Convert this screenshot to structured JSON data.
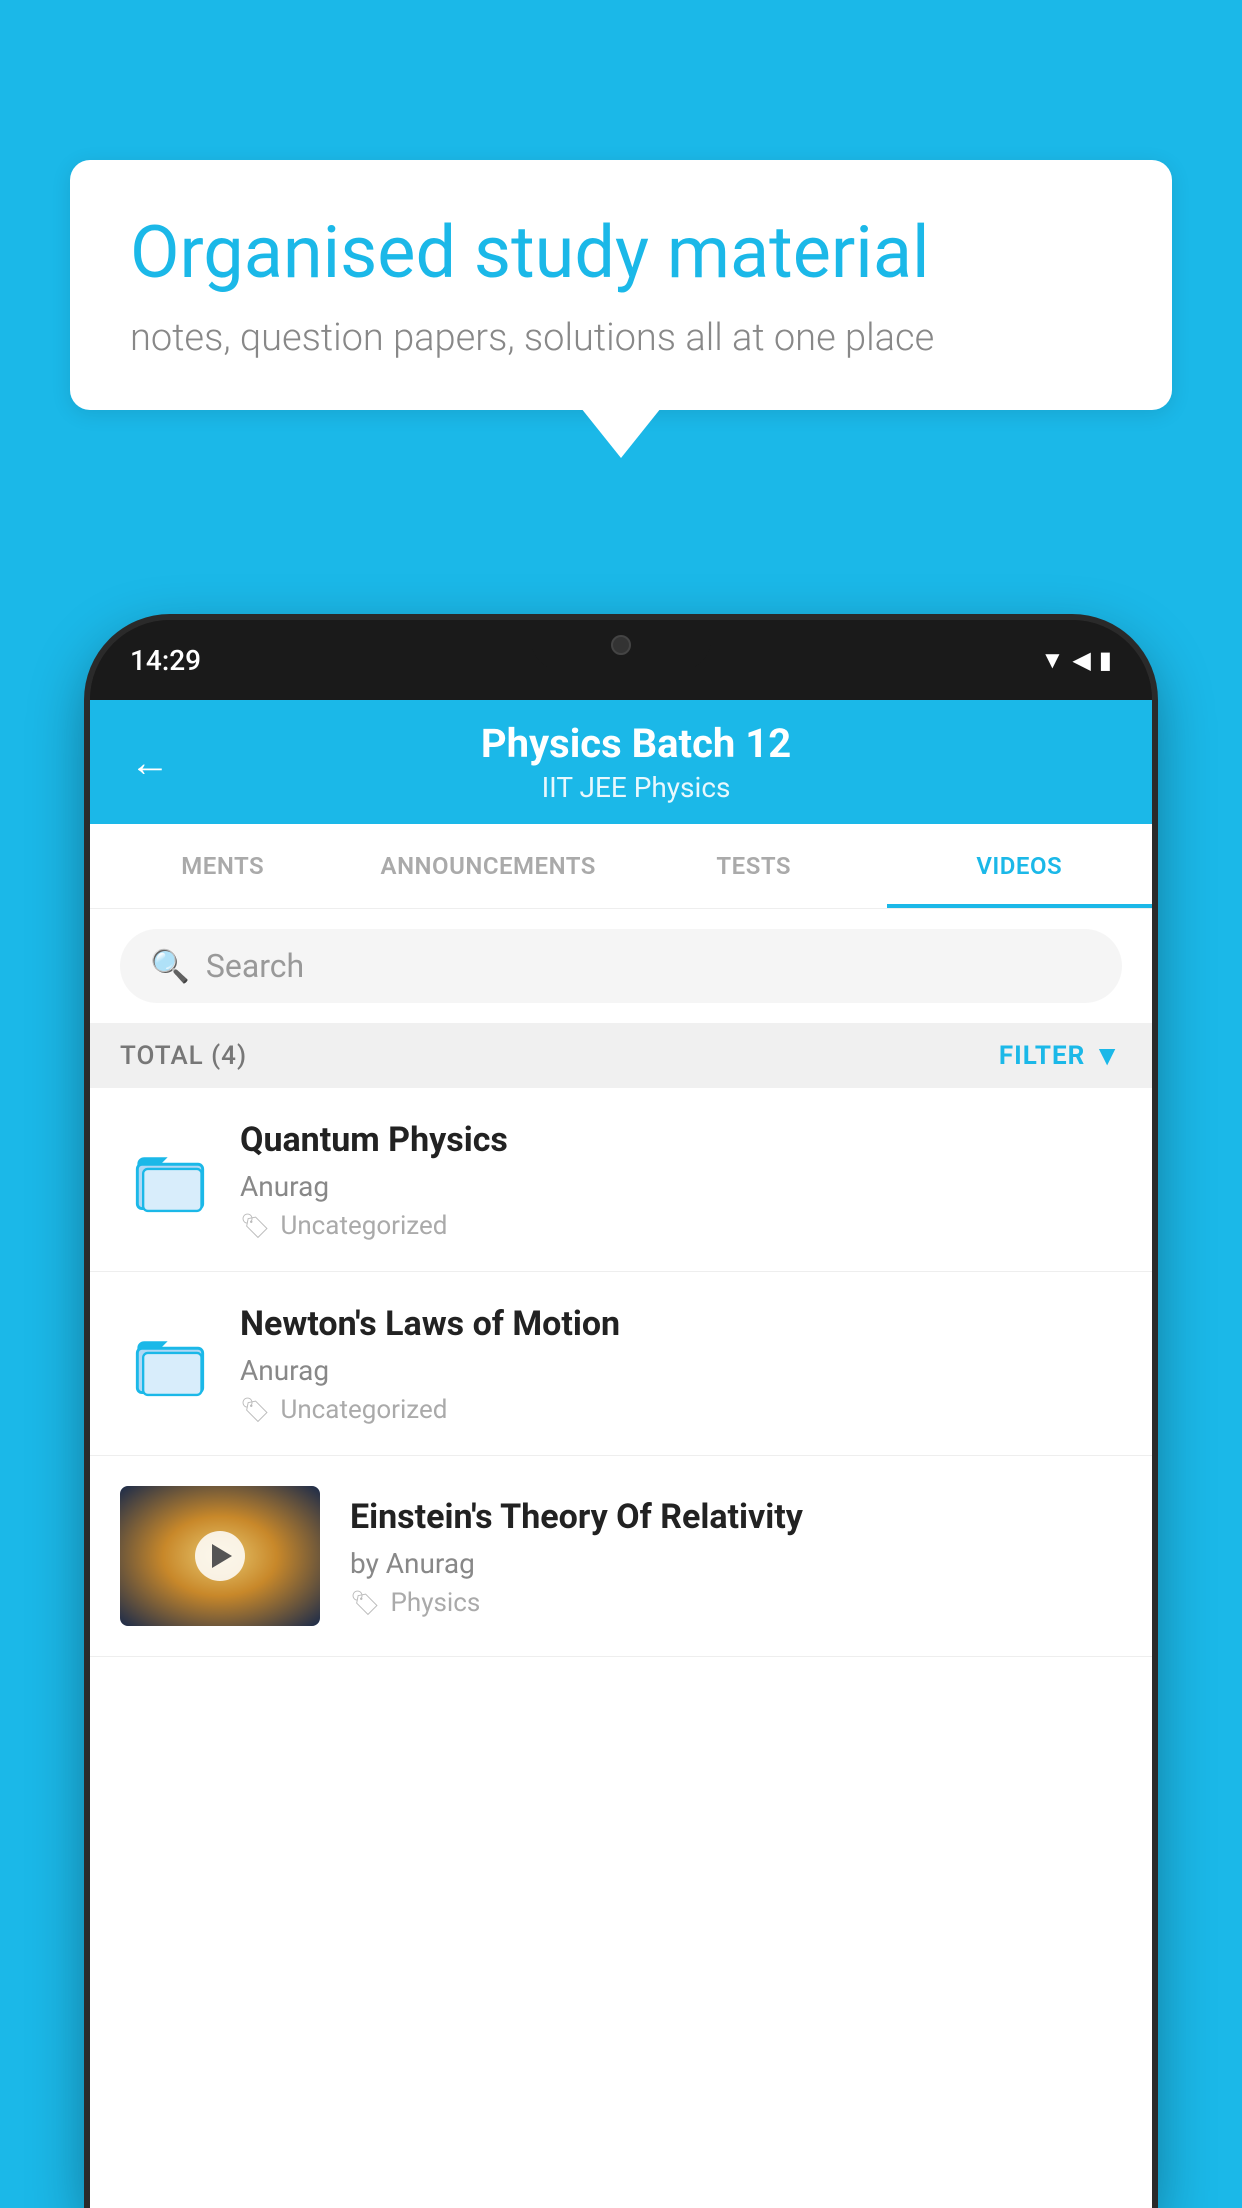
{
  "background_color": "#1BB8E8",
  "speech_bubble": {
    "title": "Organised study material",
    "subtitle": "notes, question papers, solutions all at one place"
  },
  "phone": {
    "time": "14:29",
    "header": {
      "title": "Physics Batch 12",
      "subtitle": "IIT JEE   Physics"
    },
    "tabs": [
      {
        "label": "MENTS",
        "active": false
      },
      {
        "label": "ANNOUNCEMENTS",
        "active": false
      },
      {
        "label": "TESTS",
        "active": false
      },
      {
        "label": "VIDEOS",
        "active": true
      }
    ],
    "search": {
      "placeholder": "Search"
    },
    "filter": {
      "total_label": "TOTAL (4)",
      "filter_label": "FILTER"
    },
    "videos": [
      {
        "title": "Quantum Physics",
        "author": "Anurag",
        "tag": "Uncategorized",
        "has_thumbnail": false
      },
      {
        "title": "Newton's Laws of Motion",
        "author": "Anurag",
        "tag": "Uncategorized",
        "has_thumbnail": false
      },
      {
        "title": "Einstein's Theory Of Relativity",
        "author": "by Anurag",
        "tag": "Physics",
        "has_thumbnail": true
      }
    ]
  }
}
